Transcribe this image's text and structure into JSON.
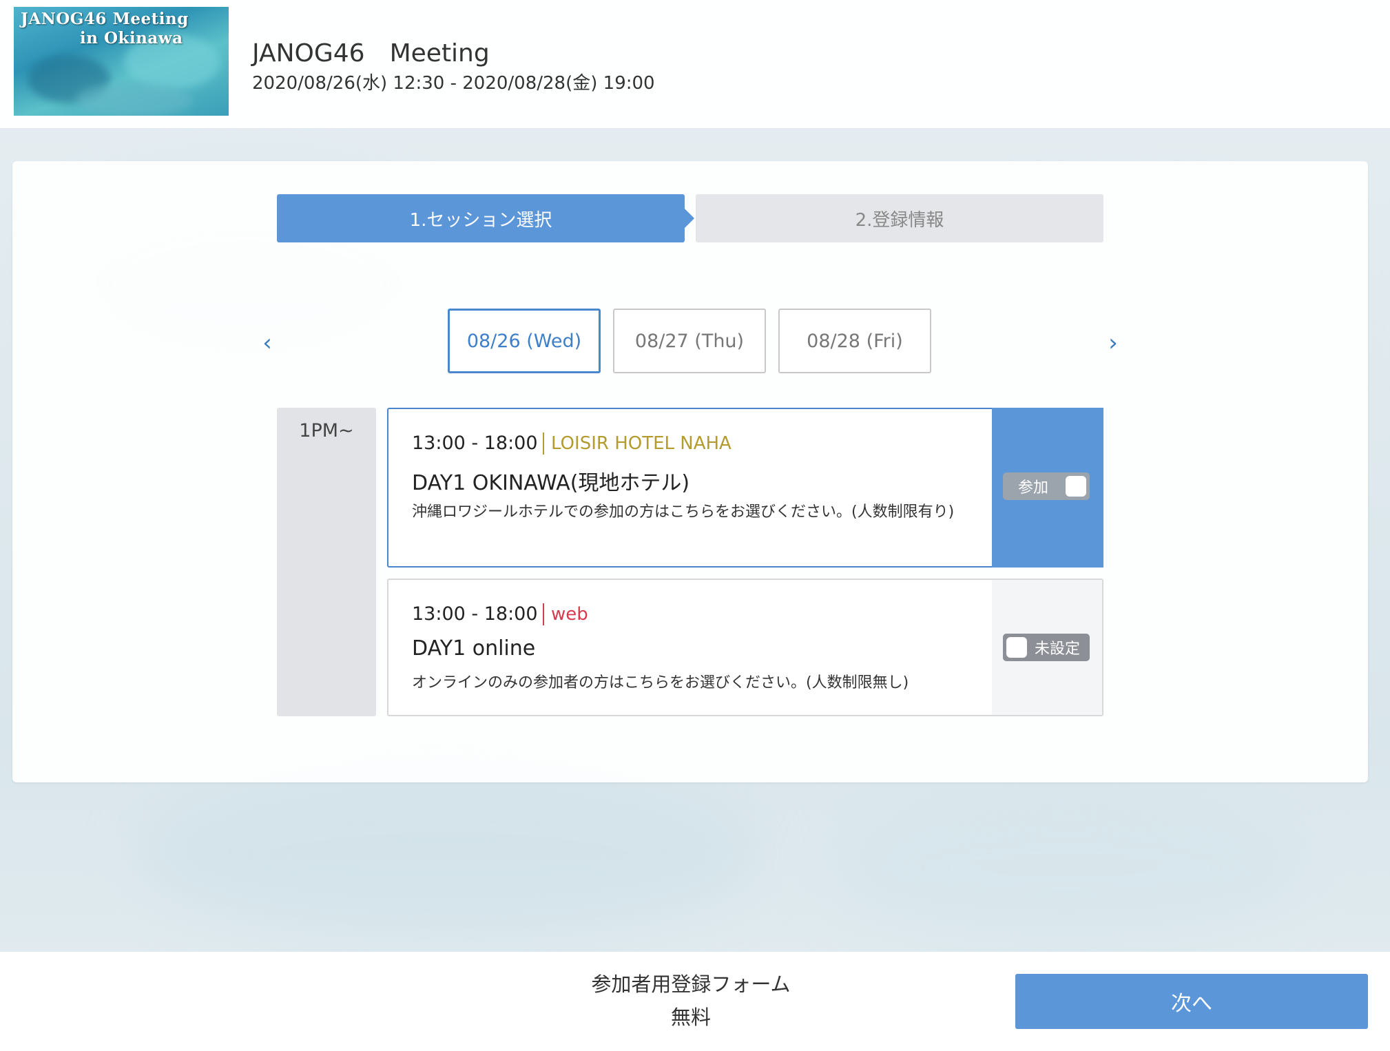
{
  "header": {
    "logo_line1": "JANOG46 Meeting",
    "logo_line2": "in Okinawa",
    "title": "JANOG46　Meeting",
    "datetime": "2020/08/26(水) 12:30 - 2020/08/28(金) 19:00"
  },
  "steps": [
    {
      "label": "1.セッション選択"
    },
    {
      "label": "2.登録情報"
    }
  ],
  "date_tabs": [
    {
      "label": "08/26 (Wed)"
    },
    {
      "label": "08/27 (Thu)"
    },
    {
      "label": "08/28 (Fri)"
    }
  ],
  "nav": {
    "prev": "‹",
    "next": "›"
  },
  "timeslot": {
    "label": "1PM~"
  },
  "sessions": [
    {
      "time": "13:00 - 18:00",
      "venue": "LOISIR HOTEL NAHA",
      "venue_color": "#b39b2e",
      "title": "DAY1 OKINAWA(現地ホテル)",
      "description": "沖縄ロワジールホテルでの参加の方はこちらをお選びください。(人数制限有り)",
      "toggle_label": "参加"
    },
    {
      "time": "13:00 - 18:00",
      "venue": "web",
      "venue_color": "#d9394e",
      "title": "DAY1 online",
      "description": "オンラインのみの参加者の方はこちらをお選びください。(人数制限無し)",
      "toggle_label": "未設定"
    }
  ],
  "footer": {
    "form_name": "参加者用登録フォーム",
    "price": "無料",
    "next_label": "次へ"
  },
  "colors": {
    "accent": "#5b96d9",
    "active_tab_border": "#4a86cc"
  }
}
